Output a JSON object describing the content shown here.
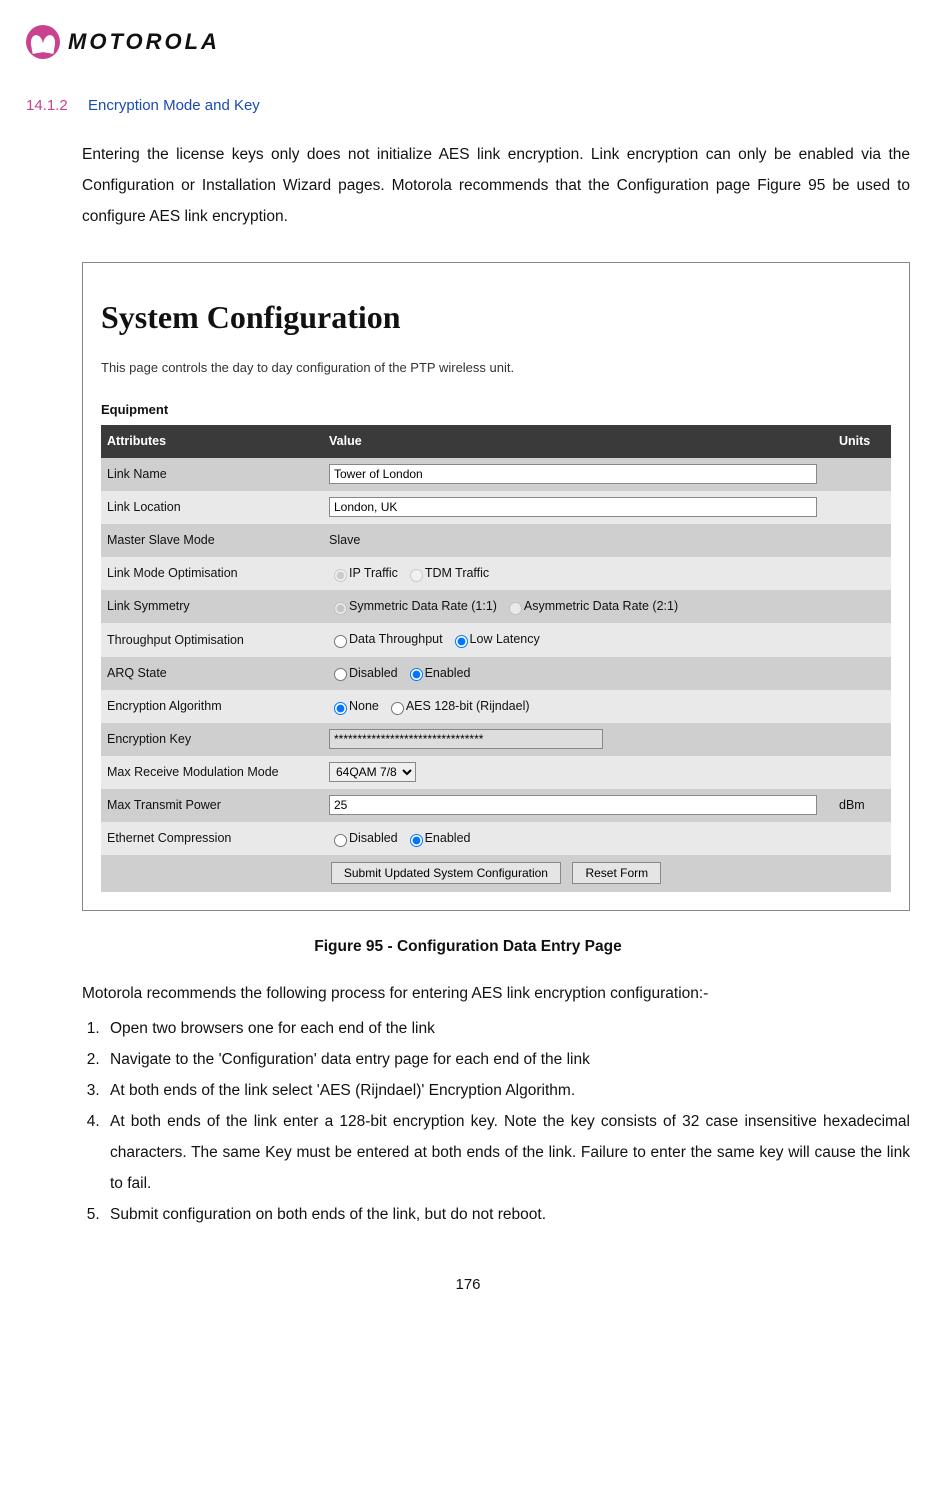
{
  "brand": {
    "wordmark": "MOTOROLA"
  },
  "section": {
    "number": "14.1.2",
    "title": "Encryption Mode and Key"
  },
  "intro": "Entering the license keys only does not initialize AES link encryption. Link encryption can only be enabled via the Configuration or Installation Wizard pages. Motorola recommends that the Configuration page Figure 95 be used to configure AES link encryption.",
  "figure": {
    "heading": "System Configuration",
    "sub": "This page controls the day to day configuration of the PTP wireless unit.",
    "equipment_label": "Equipment",
    "columns": {
      "attr": "Attributes",
      "value": "Value",
      "units": "Units"
    },
    "rows": {
      "link_name": {
        "label": "Link Name",
        "value": "Tower of London"
      },
      "link_location": {
        "label": "Link Location",
        "value": "London, UK"
      },
      "master_slave": {
        "label": "Master Slave Mode",
        "value": "Slave"
      },
      "link_mode_opt": {
        "label": "Link Mode Optimisation",
        "opt1": "IP Traffic",
        "opt2": "TDM Traffic"
      },
      "link_symmetry": {
        "label": "Link Symmetry",
        "opt1": "Symmetric Data Rate (1:1)",
        "opt2": "Asymmetric Data Rate (2:1)"
      },
      "throughput_opt": {
        "label": "Throughput Optimisation",
        "opt1": "Data Throughput",
        "opt2": "Low Latency"
      },
      "arq_state": {
        "label": "ARQ State",
        "opt1": "Disabled",
        "opt2": "Enabled"
      },
      "encryption_algo": {
        "label": "Encryption Algorithm",
        "opt1": "None",
        "opt2": "AES 128-bit (Rijndael)"
      },
      "encryption_key": {
        "label": "Encryption Key",
        "value": "********************************"
      },
      "max_rx_mod": {
        "label": "Max Receive Modulation Mode",
        "value": "64QAM 7/8"
      },
      "max_tx_power": {
        "label": "Max Transmit Power",
        "value": "25",
        "units": "dBm"
      },
      "eth_comp": {
        "label": "Ethernet Compression",
        "opt1": "Disabled",
        "opt2": "Enabled"
      }
    },
    "buttons": {
      "submit": "Submit Updated System Configuration",
      "reset": "Reset Form"
    }
  },
  "caption": "Figure 95 - Configuration Data Entry Page",
  "process_intro": "Motorola recommends the following process for entering AES link encryption configuration:-",
  "steps": [
    "Open two browsers one for each end of the link",
    "Navigate to the 'Configuration' data entry page for each end of the link",
    "At both ends of the link select 'AES (Rijndael)' Encryption Algorithm.",
    "At both ends of the link enter a 128-bit encryption key. Note the key consists of 32 case insensitive hexadecimal characters. The same Key must be entered at both ends of the link. Failure to enter the same key will cause the link to fail.",
    "Submit configuration on both ends of the link, but do not reboot."
  ],
  "page_number": "176"
}
